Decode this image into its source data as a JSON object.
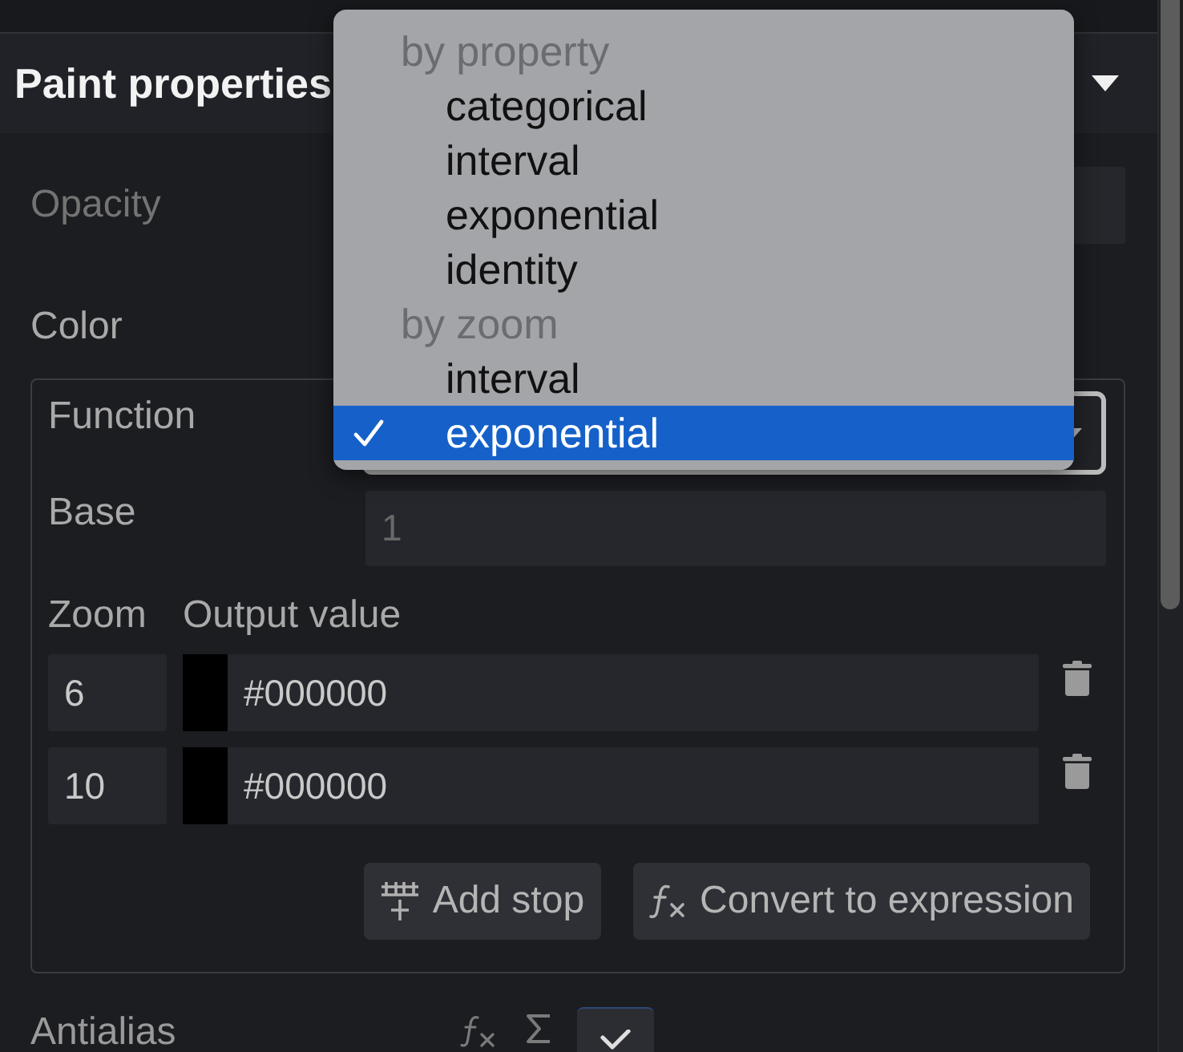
{
  "section": {
    "title": "Paint properties",
    "expanded": true
  },
  "opacity": {
    "label": "Opacity",
    "disabled": true
  },
  "color": {
    "label": "Color",
    "function_field": {
      "label": "Function",
      "focused": true
    },
    "base_field": {
      "label": "Base",
      "placeholder": "1"
    },
    "stops": {
      "columns": [
        "Zoom",
        "Output value"
      ],
      "rows": [
        {
          "zoom": "6",
          "color": "#000000",
          "value": "#000000"
        },
        {
          "zoom": "10",
          "color": "#000000",
          "value": "#000000"
        }
      ]
    },
    "buttons": [
      {
        "kind": "add_stop",
        "label": "Add stop"
      },
      {
        "kind": "convert",
        "label": "Convert to expression"
      }
    ]
  },
  "function_menu": {
    "groups": [
      {
        "heading": "by property",
        "options": [
          {
            "label": "categorical",
            "selected": false
          },
          {
            "label": "interval",
            "selected": false
          },
          {
            "label": "exponential",
            "selected": false
          },
          {
            "label": "identity",
            "selected": false
          }
        ]
      },
      {
        "heading": "by zoom",
        "options": [
          {
            "label": "interval",
            "selected": false
          },
          {
            "label": "exponential",
            "selected": true
          }
        ]
      }
    ]
  },
  "antialias": {
    "label": "Antialias",
    "checked": true
  }
}
